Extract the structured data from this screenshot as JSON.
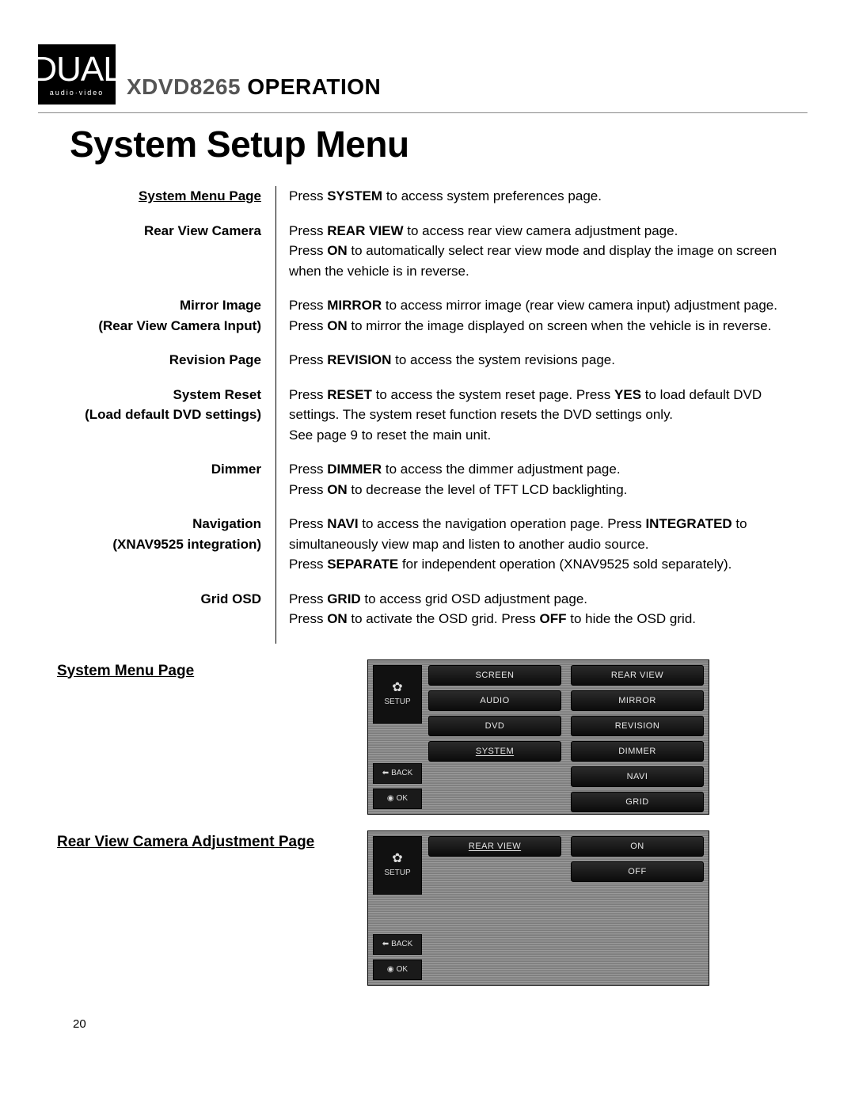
{
  "header": {
    "logo_top": "DUAL",
    "logo_sub": "audio·video",
    "model": "XDVD8265",
    "operation": "OPERATION"
  },
  "page_title": "System Setup Menu",
  "rows": [
    {
      "label": "System Menu Page",
      "underline": true,
      "text": "Press <b>SYSTEM</b> to access system preferences page."
    },
    {
      "label": "Rear View Camera",
      "text": "Press <b>REAR VIEW</b> to access rear view camera adjustment page.<br>Press <b>ON</b> to automatically select rear view mode and display the image on screen when the vehicle is in reverse."
    },
    {
      "label": "Mirror Image<br>(Rear View Camera Input)",
      "text": "Press <b>MIRROR</b> to access mirror image (rear view camera input) adjustment page. Press <b>ON</b> to mirror the image displayed on screen when the vehicle is in reverse."
    },
    {
      "label": "Revision Page",
      "text": "Press <b>REVISION</b> to access the system revisions page."
    },
    {
      "label": "System Reset<br>(Load default DVD settings)",
      "text": "Press <b>RESET</b> to access the system reset page. Press <b>YES</b> to load default DVD settings. The system reset function resets the DVD settings only.<br>See page 9 to reset the main unit."
    },
    {
      "label": "Dimmer",
      "text": "Press <b>DIMMER</b> to access the dimmer adjustment page.<br>Press <b>ON</b> to decrease the level of TFT LCD backlighting."
    },
    {
      "label": "Navigation<br>(XNAV9525 integration)",
      "text": "Press <b>NAVI</b> to access the navigation operation page. Press <b>INTEGRATED</b> to simultaneously view map and listen to another audio source.<br>Press <b>SEPARATE</b> for independent operation (XNAV9525 sold separately)."
    },
    {
      "label": "Grid OSD",
      "text": "Press <b>GRID</b> to access grid OSD adjustment page.<br>Press <b>ON</b> to activate the OSD grid. Press <b>OFF</b> to hide the OSD grid."
    }
  ],
  "screens": [
    {
      "label": "System Menu Page",
      "setup": "SETUP",
      "back": "BACK",
      "ok": "OK",
      "left_col": [
        "SCREEN",
        "AUDIO",
        "DVD",
        "SYSTEM"
      ],
      "right_col": [
        "REAR VIEW",
        "MIRROR",
        "REVISION",
        "DIMMER",
        "NAVI",
        "GRID"
      ],
      "selected": "SYSTEM",
      "height": 196
    },
    {
      "label": "Rear View Camera Adjustment Page",
      "setup": "SETUP",
      "back": "BACK",
      "ok": "OK",
      "left_col": [
        "REAR VIEW"
      ],
      "right_col": [
        "ON",
        "OFF"
      ],
      "selected": "REAR VIEW",
      "height": 196
    }
  ],
  "page_number": "20"
}
